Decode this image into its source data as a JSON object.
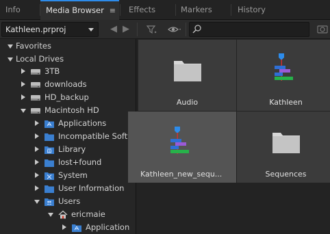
{
  "tabs": [
    {
      "label": "Info",
      "active": false
    },
    {
      "label": "Media Browser",
      "active": true,
      "menu_glyph": "≡"
    },
    {
      "label": "Effects",
      "active": false
    },
    {
      "label": "Markers",
      "active": false
    },
    {
      "label": "History",
      "active": false
    }
  ],
  "toolbar": {
    "project_selected": "Kathleen.prproj",
    "back_glyph": "◀",
    "forward_glyph": "▶",
    "filter_icon": "filter-icon",
    "view_icon": "eye-icon",
    "search_placeholder": "",
    "search_value": ""
  },
  "tree": [
    {
      "label": "Favorites",
      "level": 0,
      "toggle": "down",
      "icon": "none"
    },
    {
      "label": "Local Drives",
      "level": 0,
      "toggle": "down",
      "icon": "none"
    },
    {
      "label": "3TB",
      "level": 1,
      "toggle": "right",
      "icon": "drive-icon"
    },
    {
      "label": "downloads",
      "level": 1,
      "toggle": "right",
      "icon": "drive-icon"
    },
    {
      "label": "HD_backup",
      "level": 1,
      "toggle": "right",
      "icon": "drive-icon"
    },
    {
      "label": "Macintosh HD",
      "level": 1,
      "toggle": "down",
      "icon": "drive-icon"
    },
    {
      "label": "Applications",
      "level": 2,
      "toggle": "right",
      "icon": "applications-folder-icon"
    },
    {
      "label": "Incompatible Softw",
      "level": 2,
      "toggle": "right",
      "icon": "folder-icon"
    },
    {
      "label": "Library",
      "level": 2,
      "toggle": "right",
      "icon": "library-folder-icon"
    },
    {
      "label": "lost+found",
      "level": 2,
      "toggle": "right",
      "icon": "folder-icon"
    },
    {
      "label": "System",
      "level": 2,
      "toggle": "right",
      "icon": "system-folder-icon"
    },
    {
      "label": "User Information",
      "level": 2,
      "toggle": "right",
      "icon": "folder-icon"
    },
    {
      "label": "Users",
      "level": 2,
      "toggle": "down",
      "icon": "users-folder-icon"
    },
    {
      "label": "ericmaie",
      "level": 3,
      "toggle": "down",
      "icon": "home-icon"
    },
    {
      "label": "Application",
      "level": 4,
      "toggle": "right",
      "icon": "applications-folder-icon"
    }
  ],
  "grid": [
    {
      "name": "Audio",
      "type": "folder",
      "selected": false
    },
    {
      "name": "Kathleen",
      "type": "sequence",
      "selected": false
    },
    {
      "name": "Kathleen_new_sequ...",
      "type": "sequence",
      "selected": true
    },
    {
      "name": "Sequences",
      "type": "folder",
      "selected": false
    }
  ],
  "colors": {
    "accent": "#2d8ceb",
    "folder_blue": "#3a7fd0",
    "seq_blue": "#2f6fd6",
    "seq_purple": "#9b5ad6",
    "seq_green": "#27b24a"
  }
}
